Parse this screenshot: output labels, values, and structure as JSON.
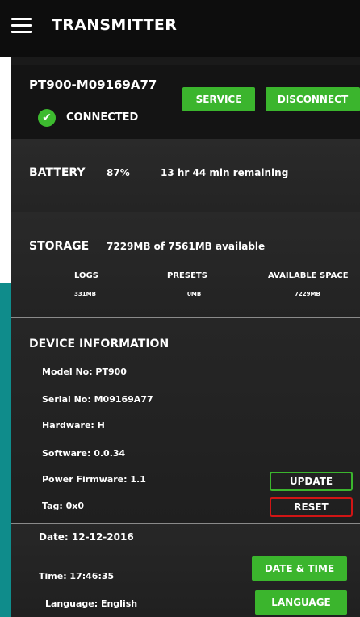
{
  "header": {
    "title": "TRANSMITTER",
    "menu_icon": "hamburger-menu-icon"
  },
  "connection": {
    "device_name": "PT900-M09169A77",
    "status": "CONNECTED",
    "status_icon": "check-circle-icon",
    "status_color": "#3dbb2f",
    "service_label": "SERVICE",
    "disconnect_label": "DISCONNECT"
  },
  "battery": {
    "label": "BATTERY",
    "percent": "87%",
    "remaining": "13 hr 44 min remaining"
  },
  "storage": {
    "label": "STORAGE",
    "summary": "7229MB of 7561MB available",
    "columns": [
      "LOGS",
      "PRESETS",
      "AVAILABLE SPACE"
    ],
    "values": [
      "331MB",
      "0MB",
      "7229MB"
    ]
  },
  "device_info": {
    "title": "DEVICE INFORMATION",
    "model": "Model No: PT900",
    "serial": "Serial No: M09169A77",
    "hardware": "Hardware: H",
    "software": "Software: 0.0.34",
    "power_firmware": "Power Firmware: 1.1",
    "tag": "Tag: 0x0",
    "update_label": "UPDATE",
    "reset_label": "RESET"
  },
  "settings": {
    "date": "Date: 12-12-2016",
    "time": "Time: 17:46:35",
    "language": "Language: English",
    "datetime_label": "DATE & TIME",
    "language_label": "LANGUAGE"
  },
  "colors": {
    "accent_green": "#3bb52d",
    "reset_red": "#d11515",
    "teal": "#0f8c8b"
  }
}
